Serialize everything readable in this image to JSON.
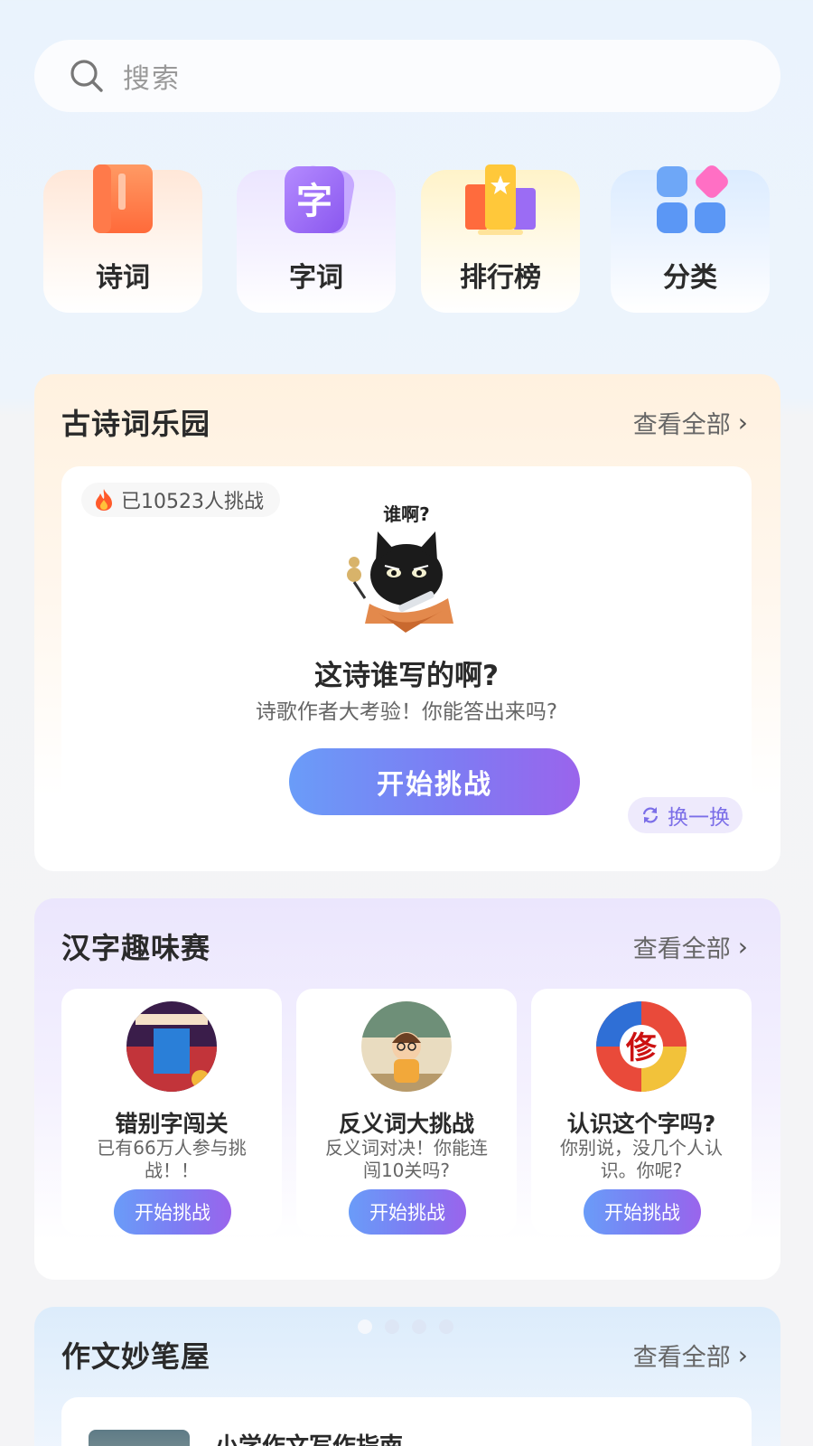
{
  "search": {
    "placeholder": "搜索"
  },
  "categories": [
    {
      "label": "诗词",
      "icon": "book-icon"
    },
    {
      "label": "字词",
      "icon": "character-icon",
      "glyph": "字"
    },
    {
      "label": "排行榜",
      "icon": "ranking-icon"
    },
    {
      "label": "分类",
      "icon": "grid-icon"
    }
  ],
  "poetry_section": {
    "title": "古诗词乐园",
    "see_all": "查看全部",
    "card": {
      "badge": "已10523人挑战",
      "speech": "谁啊?",
      "question_title": "这诗谁写的啊?",
      "question_sub": "诗歌作者大考验！你能答出来吗?",
      "button": "开始挑战",
      "swap": "换一换"
    }
  },
  "hanzi_section": {
    "title": "汉字趣味赛",
    "see_all": "查看全部",
    "games": [
      {
        "title": "错别字闯关",
        "desc": "已有66万人参与挑战！！",
        "button": "开始挑战"
      },
      {
        "title": "反义词大挑战",
        "desc": "反义词对决！你能连闯10关吗?",
        "button": "开始挑战"
      },
      {
        "title": "认识这个字吗?",
        "desc": "你别说，没几个人认识。你呢?",
        "button": "开始挑战",
        "glyph": "俢"
      }
    ]
  },
  "essay_section": {
    "title": "作文妙笔屋",
    "see_all": "查看全部",
    "first_item": "小学作文写作指南"
  },
  "colors": {
    "accent_gradient_start": "#6a9cf8",
    "accent_gradient_end": "#9a64ec",
    "poetry_bg": "#fff1df",
    "hanzi_bg": "#ebe6fd",
    "essay_bg": "#dcecfb"
  }
}
